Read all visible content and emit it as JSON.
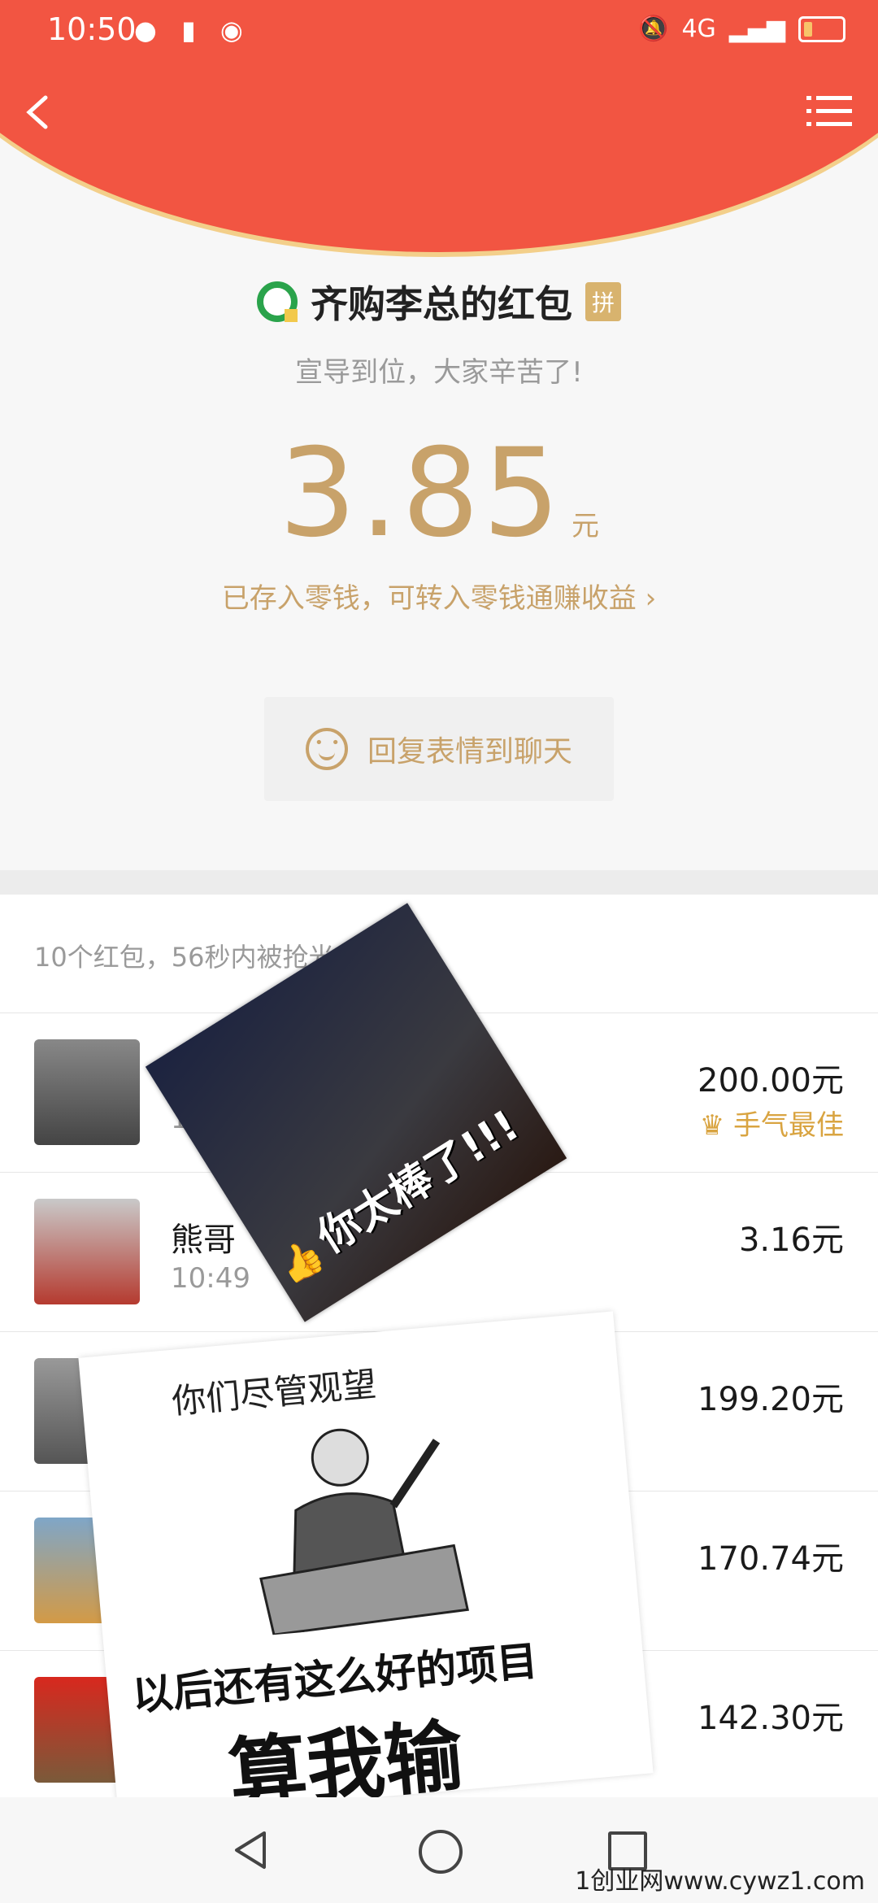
{
  "status_bar": {
    "time": "10:50",
    "signal": "4G"
  },
  "header": {
    "back_icon": "chevron-left-icon",
    "menu_icon": "list-menu-icon"
  },
  "packet": {
    "sender": "齐购李总的红包",
    "badge": "拼",
    "greeting": "宣导到位，大家辛苦了!",
    "amount": "3.85",
    "unit": "元",
    "stored_note": "已存入零钱，可转入零钱通赚收益",
    "reply_label": "回复表情到聊天"
  },
  "list": {
    "summary": "10个红包，56秒内被抢光",
    "rows": [
      {
        "name": "",
        "time": "10:",
        "amount": "200.00元",
        "best": "手气最佳"
      },
      {
        "name": "熊哥",
        "time": "10:49",
        "amount": "3.16元"
      },
      {
        "name": "",
        "time": "",
        "amount": "199.20元"
      },
      {
        "name": "",
        "time": "",
        "amount": "170.74元"
      },
      {
        "name": "",
        "time": "",
        "amount": "142.30元"
      }
    ]
  },
  "memes": {
    "first_caption": "你太棒了!!!",
    "second_top": "你们尽管观望",
    "second_line1": "以后还有这么好的项目",
    "second_line2": "算我输"
  },
  "watermark": "1创业网www.cywz1.com",
  "colors": {
    "header_red": "#f25542",
    "gold": "#c8a26a",
    "best_gold": "#d9a441"
  }
}
